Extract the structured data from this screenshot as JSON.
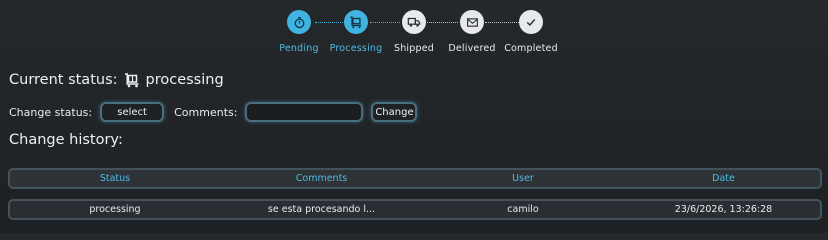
{
  "stepper": {
    "steps": [
      {
        "label": "Pending",
        "icon": "timer-icon",
        "state": "active"
      },
      {
        "label": "Processing",
        "icon": "package-cart-icon",
        "state": "active"
      },
      {
        "label": "Shipped",
        "icon": "truck-icon",
        "state": "inactive"
      },
      {
        "label": "Delivered",
        "icon": "envelope-icon",
        "state": "inactive"
      },
      {
        "label": "Completed",
        "icon": "check-icon",
        "state": "inactive"
      }
    ]
  },
  "status": {
    "prefix": "Current status:",
    "icon": "package-cart-icon",
    "value": "processing"
  },
  "change": {
    "label": "Change status:",
    "select_value": "select",
    "comments_label": "Comments:",
    "comments_value": "",
    "submit_label": "Change"
  },
  "history": {
    "title": "Change history:",
    "columns": [
      "Status",
      "Comments",
      "User",
      "Date"
    ],
    "rows": [
      {
        "status": "processing",
        "comments": "se esta procesando l...",
        "user": "camilo",
        "date": "23/6/2026, 13:26:28"
      }
    ]
  },
  "colors": {
    "accent": "#3fb4e0",
    "background": "#23262a",
    "inactive_step": "#e7e9eb"
  }
}
